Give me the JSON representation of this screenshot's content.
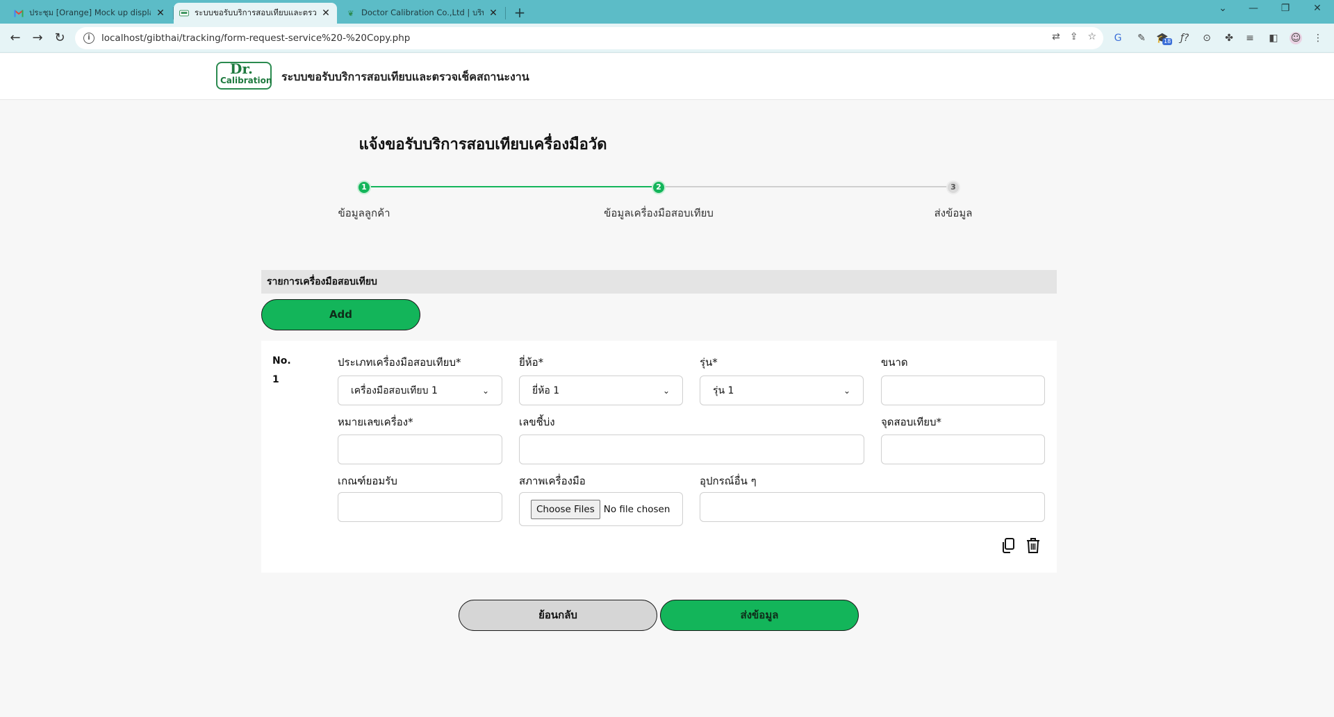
{
  "browser": {
    "tabs": [
      {
        "title": "ประชุม [Orange] Mock up display",
        "favicon": "gmail-icon"
      },
      {
        "title": "ระบบขอรับบริการสอบเทียบและตรวจเช็ค",
        "favicon": "doctor-calibration-icon"
      },
      {
        "title": "Doctor Calibration Co.,Ltd | บริษัท",
        "favicon": "leaf-icon"
      }
    ],
    "url": "localhost/gibthai/tracking/form-request-service%20-%20Copy.php",
    "extension_badge": "18"
  },
  "app": {
    "logo_text_top": "Dr.",
    "logo_text_bottom": "Calibration",
    "title": "ระบบขอรับบริการสอบเทียบและตรวจเช็คสถานะงาน"
  },
  "page": {
    "title": "แจ้งขอรับบริการสอบเทียบเครื่องมือวัด",
    "steps": [
      {
        "number": "1",
        "label": "ข้อมูลลูกค้า",
        "state": "done"
      },
      {
        "number": "2",
        "label": "ข้อมูลเครื่องมือสอบเทียบ",
        "state": "done"
      },
      {
        "number": "3",
        "label": "ส่งข้อมูล",
        "state": "todo"
      }
    ],
    "accent_color": "#13b55a"
  },
  "instruments": {
    "section_title": "รายการเครื่องมือสอบเทียบ",
    "add_label": "Add",
    "item": {
      "no_label": "No.",
      "no_value": "1",
      "type_label": "ประเภทเครื่องมือสอบเทียบ*",
      "type_value": "เครื่องมือสอบเทียบ 1",
      "brand_label": "ยี่ห้อ*",
      "brand_value": "ยี่ห้อ 1",
      "model_label": "รุ่น*",
      "model_value": "รุ่น 1",
      "size_label": "ขนาด",
      "size_value": "",
      "serial_label": "หมายเลขเครื่อง*",
      "serial_value": "",
      "indicator_label": "เลขชี้บ่ง",
      "indicator_value": "",
      "points_label": "จุดสอบเทียบ*",
      "points_value": "",
      "criteria_label": "เกณฑ์ยอมรับ",
      "criteria_value": "",
      "condition_label": "สภาพเครื่องมือ",
      "choose_files_label": "Choose Files",
      "no_file_text": "No file chosen",
      "accessories_label": "อุปกรณ์อื่น ๆ",
      "accessories_value": ""
    }
  },
  "footer_buttons": {
    "back_label": "ย้อนกลับ",
    "submit_label": "ส่งข้อมูล"
  }
}
